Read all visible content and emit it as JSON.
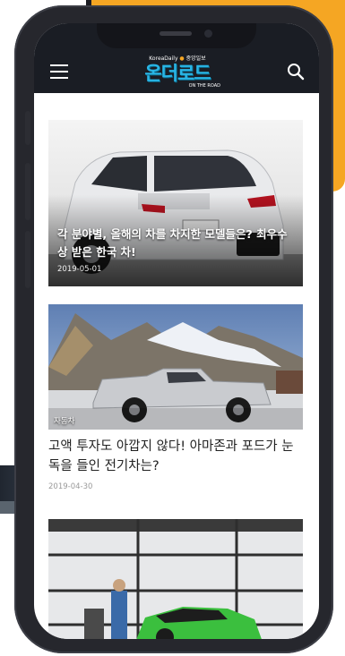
{
  "colors": {
    "orange": "#f5a623",
    "appbar_bg": "#1a1d24",
    "logo_blue": "#29b6e6"
  },
  "header": {
    "menu_icon": "menu-icon",
    "logo_top": "KoreaDaily",
    "logo_top_kr": "중앙일보",
    "logo_main": "온더로드",
    "logo_sub": "ON THE ROAD",
    "search_icon": "search-icon"
  },
  "articles": [
    {
      "title": "각 분야별, 올해의 차를 차지한 모델들은? 최우수상 받은 한국 차!",
      "date": "2019-05-01"
    },
    {
      "category": "자동차",
      "title": "고액 투자도 아깝지 않다! 아마존과 포드가 눈독을 들인 전기차는?",
      "date": "2019-04-30"
    }
  ]
}
